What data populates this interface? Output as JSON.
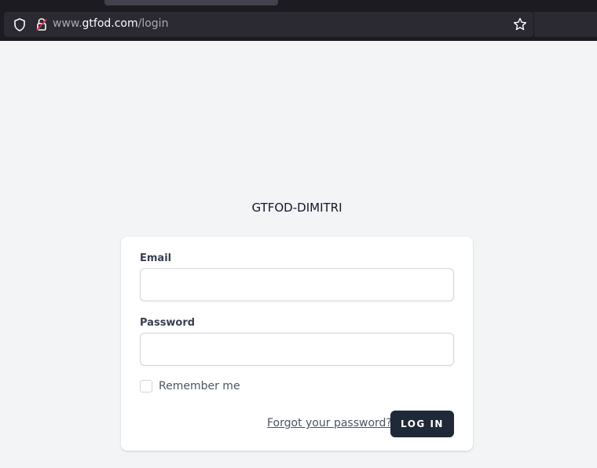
{
  "browser": {
    "url_host": "www.gtfod.com",
    "url_path": "/login"
  },
  "page": {
    "title": "GTFOD-DIMITRI"
  },
  "login_form": {
    "email_label": "Email",
    "email_value": "",
    "password_label": "Password",
    "password_value": "",
    "remember_label": "Remember me",
    "remember_checked": false,
    "forgot_link": "Forgot your password?",
    "submit_label": "LOG IN"
  },
  "colors": {
    "page_bg": "#f3f4f6",
    "button_bg": "#1f2937",
    "chrome_bg": "#1c1b22"
  },
  "icons": [
    "shield-icon",
    "lock-icon",
    "star-icon"
  ]
}
